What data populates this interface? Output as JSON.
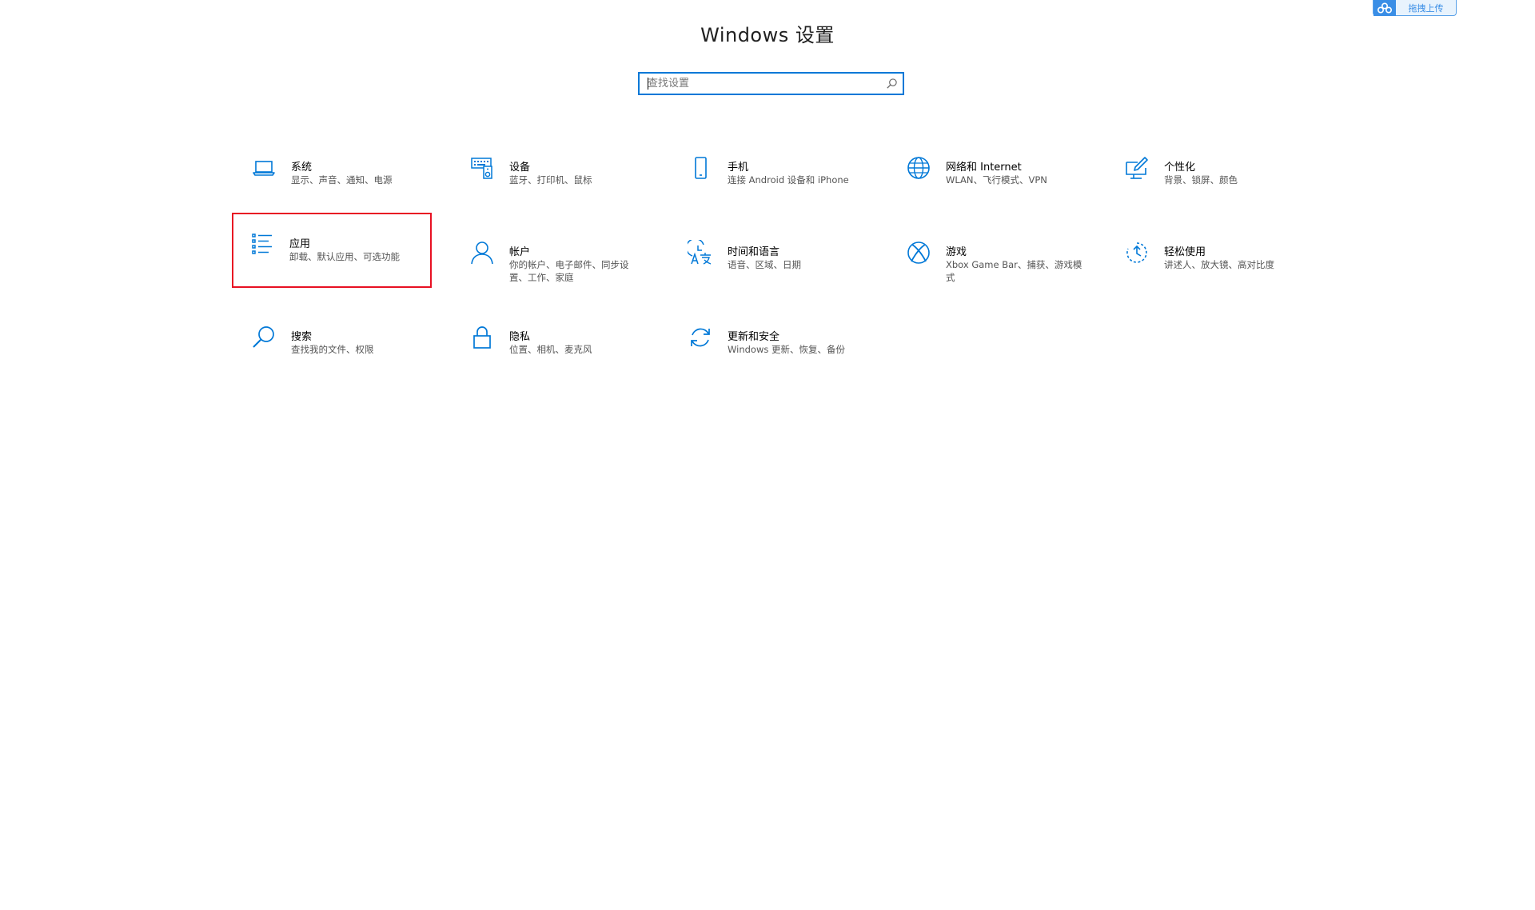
{
  "window": {
    "title": "Windows 设置"
  },
  "search": {
    "placeholder": "查找设置",
    "value": ""
  },
  "upload_button": {
    "label": "拖拽上传"
  },
  "accent_color": "#0078d7",
  "selection_color": "#e81123",
  "tiles": [
    {
      "name": "系统",
      "desc": "显示、声音、通知、电源",
      "icon": "laptop-icon"
    },
    {
      "name": "设备",
      "desc": "蓝牙、打印机、鼠标",
      "icon": "keyboard-speaker-icon"
    },
    {
      "name": "手机",
      "desc": "连接 Android 设备和 iPhone",
      "icon": "phone-icon"
    },
    {
      "name": "网络和 Internet",
      "desc": "WLAN、飞行模式、VPN",
      "icon": "globe-icon"
    },
    {
      "name": "个性化",
      "desc": "背景、锁屏、颜色",
      "icon": "paint-icon"
    },
    {
      "name": "应用",
      "desc": "卸载、默认应用、可选功能",
      "icon": "apps-list-icon",
      "selected": true
    },
    {
      "name": "帐户",
      "desc": "你的帐户、电子邮件、同步设置、工作、家庭",
      "icon": "person-icon"
    },
    {
      "name": "时间和语言",
      "desc": "语音、区域、日期",
      "icon": "time-language-icon"
    },
    {
      "name": "游戏",
      "desc": "Xbox Game Bar、捕获、游戏模式",
      "icon": "xbox-icon"
    },
    {
      "name": "轻松使用",
      "desc": "讲述人、放大镜、高对比度",
      "icon": "ease-of-access-icon"
    },
    {
      "name": "搜索",
      "desc": "查找我的文件、权限",
      "icon": "search-magnifier-icon"
    },
    {
      "name": "隐私",
      "desc": "位置、相机、麦克风",
      "icon": "lock-icon"
    },
    {
      "name": "更新和安全",
      "desc": "Windows 更新、恢复、备份",
      "icon": "sync-icon"
    }
  ]
}
